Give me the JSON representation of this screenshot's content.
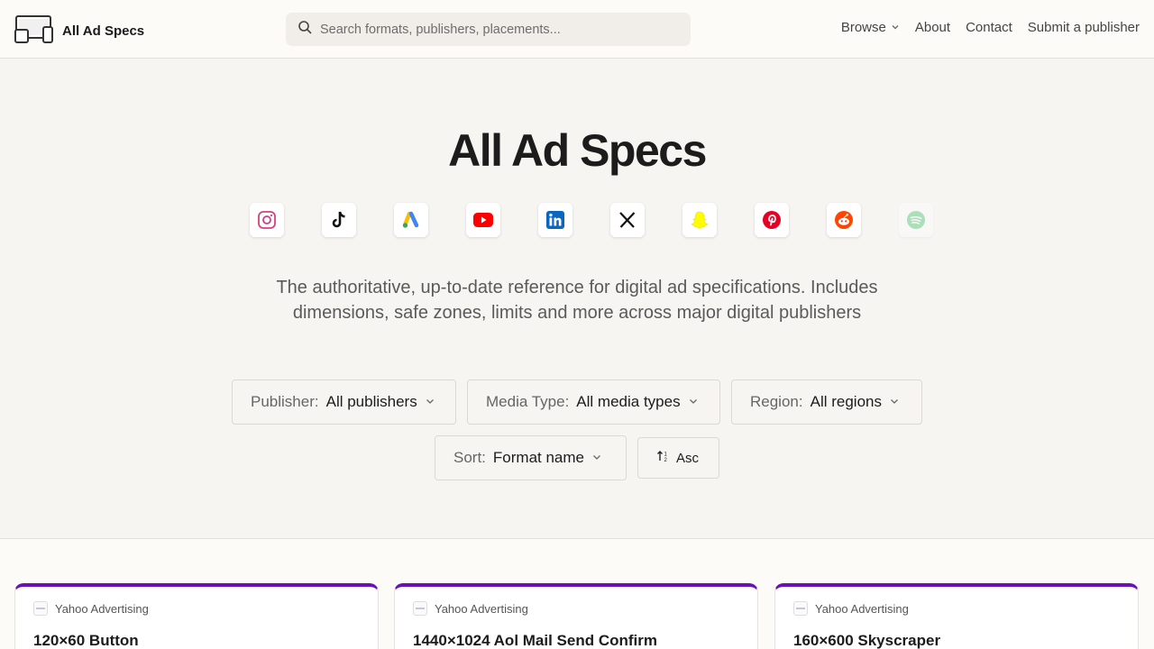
{
  "header": {
    "brand": "All Ad Specs",
    "search_placeholder": "Search formats, publishers, placements...",
    "nav": {
      "browse": "Browse",
      "about": "About",
      "contact": "Contact",
      "submit": "Submit a publisher"
    }
  },
  "hero": {
    "title": "All Ad Specs",
    "publisher_logos": [
      "instagram-icon",
      "tiktok-icon",
      "google-ads-icon",
      "youtube-icon",
      "linkedin-icon",
      "x-icon",
      "snapchat-icon",
      "pinterest-icon",
      "reddit-icon",
      "spotify-icon"
    ],
    "tagline": "The authoritative, up-to-date reference for digital ad specifications. Includes dimensions, safe zones, limits and more across major digital publishers"
  },
  "filters": {
    "publisher": {
      "label": "Publisher:",
      "value": "All publishers"
    },
    "media_type": {
      "label": "Media Type:",
      "value": "All media types"
    },
    "region": {
      "label": "Region:",
      "value": "All regions"
    },
    "sort": {
      "label": "Sort:",
      "value": "Format name"
    },
    "order": "Asc"
  },
  "cards": [
    {
      "publisher": "Yahoo Advertising",
      "title": "120×60 Button"
    },
    {
      "publisher": "Yahoo Advertising",
      "title": "1440×1024 Aol Mail Send Confirm"
    },
    {
      "publisher": "Yahoo Advertising",
      "title": "160×600 Skyscraper"
    }
  ],
  "colors": {
    "card_accent": "#6a10b8",
    "background": "#f7f5f2"
  }
}
